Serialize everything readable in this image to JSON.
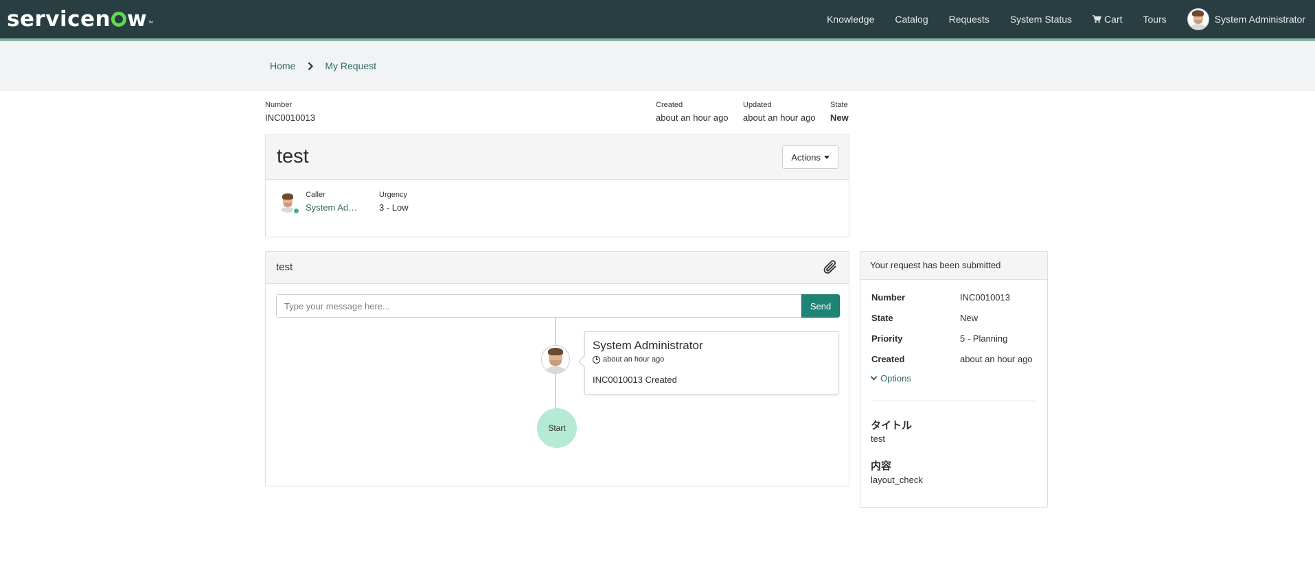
{
  "header": {
    "logo_text_a": "servicen",
    "logo_text_b": "w",
    "logo_tm": "™",
    "nav": {
      "knowledge": "Knowledge",
      "catalog": "Catalog",
      "requests": "Requests",
      "system_status": "System Status",
      "cart": "Cart",
      "tours": "Tours",
      "user": "System Administrator"
    },
    "colors": {
      "bar": "#293e40",
      "accent": "#81b5a1"
    }
  },
  "breadcrumb": {
    "home": "Home",
    "current": "My Request"
  },
  "meta": {
    "number_label": "Number",
    "number_value": "INC0010013",
    "created_label": "Created",
    "created_value": "about an hour ago",
    "updated_label": "Updated",
    "updated_value": "about an hour ago",
    "state_label": "State",
    "state_value": "New"
  },
  "ticket": {
    "title": "test",
    "actions_label": "Actions",
    "caller_label": "Caller",
    "caller_value": "System Ad…",
    "urgency_label": "Urgency",
    "urgency_value": "3 - Low"
  },
  "activity": {
    "title": "test",
    "input_placeholder": "Type your message here...",
    "send_label": "Send",
    "entry": {
      "author": "System Administrator",
      "time": "about an hour ago",
      "text": "INC0010013 Created"
    },
    "start_label": "Start",
    "colors": {
      "send": "#1f8476",
      "start": "#b5ead5"
    }
  },
  "side": {
    "heading": "Your request has been submitted",
    "rows": [
      {
        "key": "Number",
        "value": "INC0010013"
      },
      {
        "key": "State",
        "value": "New"
      },
      {
        "key": "Priority",
        "value": "5 - Planning"
      },
      {
        "key": "Created",
        "value": "about an hour ago"
      }
    ],
    "options_label": "Options",
    "variables": [
      {
        "label": "タイトル",
        "value": "test"
      },
      {
        "label": "内容",
        "value": "layout_check"
      }
    ]
  },
  "icons": [
    "user-avatar-icon",
    "cart-icon",
    "chevron-right-icon",
    "caret-down-icon",
    "presence-icon",
    "paperclip-icon",
    "clock-icon",
    "chevron-down-icon"
  ]
}
